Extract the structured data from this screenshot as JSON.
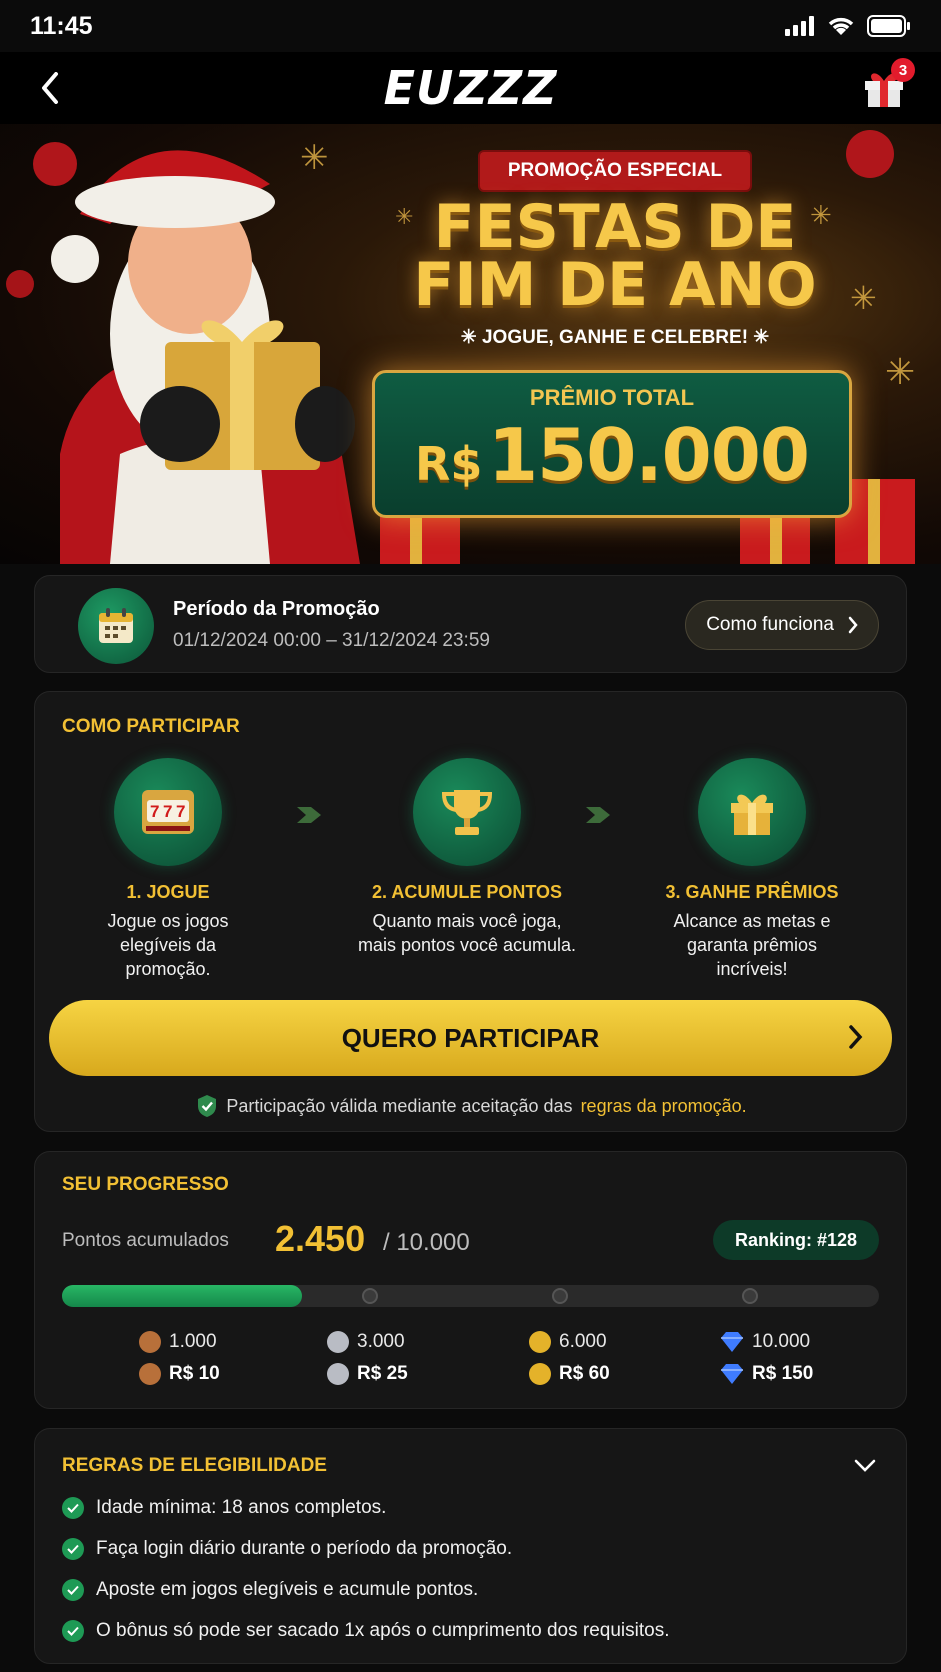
{
  "status_bar": {
    "time": "11:45"
  },
  "header": {
    "logo": "EUZZZ",
    "gift_badge": "3"
  },
  "hero": {
    "tag": "PROMOÇÃO ESPECIAL",
    "title_line1": "FESTAS DE",
    "title_line2": "FIM DE ANO",
    "tagline": "✳ JOGUE, GANHE E CELEBRE! ✳",
    "prize_label": "PRÊMIO TOTAL",
    "prize_currency": "R$",
    "prize_amount": "150.000"
  },
  "period": {
    "title": "Período da Promoção",
    "dates": "01/12/2024 00:00 – 31/12/2024 23:59",
    "how_button": "Como funciona"
  },
  "participate": {
    "title": "COMO PARTICIPAR",
    "steps": [
      {
        "title": "1. JOGUE",
        "desc": "Jogue os jogos elegíveis da promoção.",
        "icon": "slot-machine-icon"
      },
      {
        "title": "2. ACUMULE PONTOS",
        "desc": "Quanto mais você joga, mais pontos você acumula.",
        "icon": "trophy-icon"
      },
      {
        "title": "3. GANHE PRÊMIOS",
        "desc": "Alcance as metas e garanta prêmios incríveis!",
        "icon": "gift-icon"
      }
    ],
    "cta": "QUERO PARTICIPAR",
    "note_prefix": "Participação válida mediante aceitação das",
    "note_link": "regras da promoção."
  },
  "progress": {
    "title": "SEU PROGRESSO",
    "points_label": "Pontos acumulados",
    "points": "2.450",
    "goal": "/ 10.000",
    "ranking": "Ranking: #128",
    "fill_fraction": 0.245,
    "tiers": [
      {
        "points": "1.000",
        "reward": "R$ 10",
        "color": "#b8703a"
      },
      {
        "points": "3.000",
        "reward": "R$ 25",
        "color": "#b9bcc4"
      },
      {
        "points": "6.000",
        "reward": "R$ 60",
        "color": "#e4b22a"
      },
      {
        "points": "10.000",
        "reward": "R$ 150",
        "color": "#3f7cff"
      }
    ]
  },
  "rules": {
    "title": "REGRAS DE ELEGIBILIDADE",
    "items": [
      "Idade mínima: 18 anos completos.",
      "Faça login diário durante o período da promoção.",
      "Aposte em jogos elegíveis e acumule pontos.",
      "O bônus só pode ser sacado 1x após o cumprimento dos requisitos."
    ]
  }
}
